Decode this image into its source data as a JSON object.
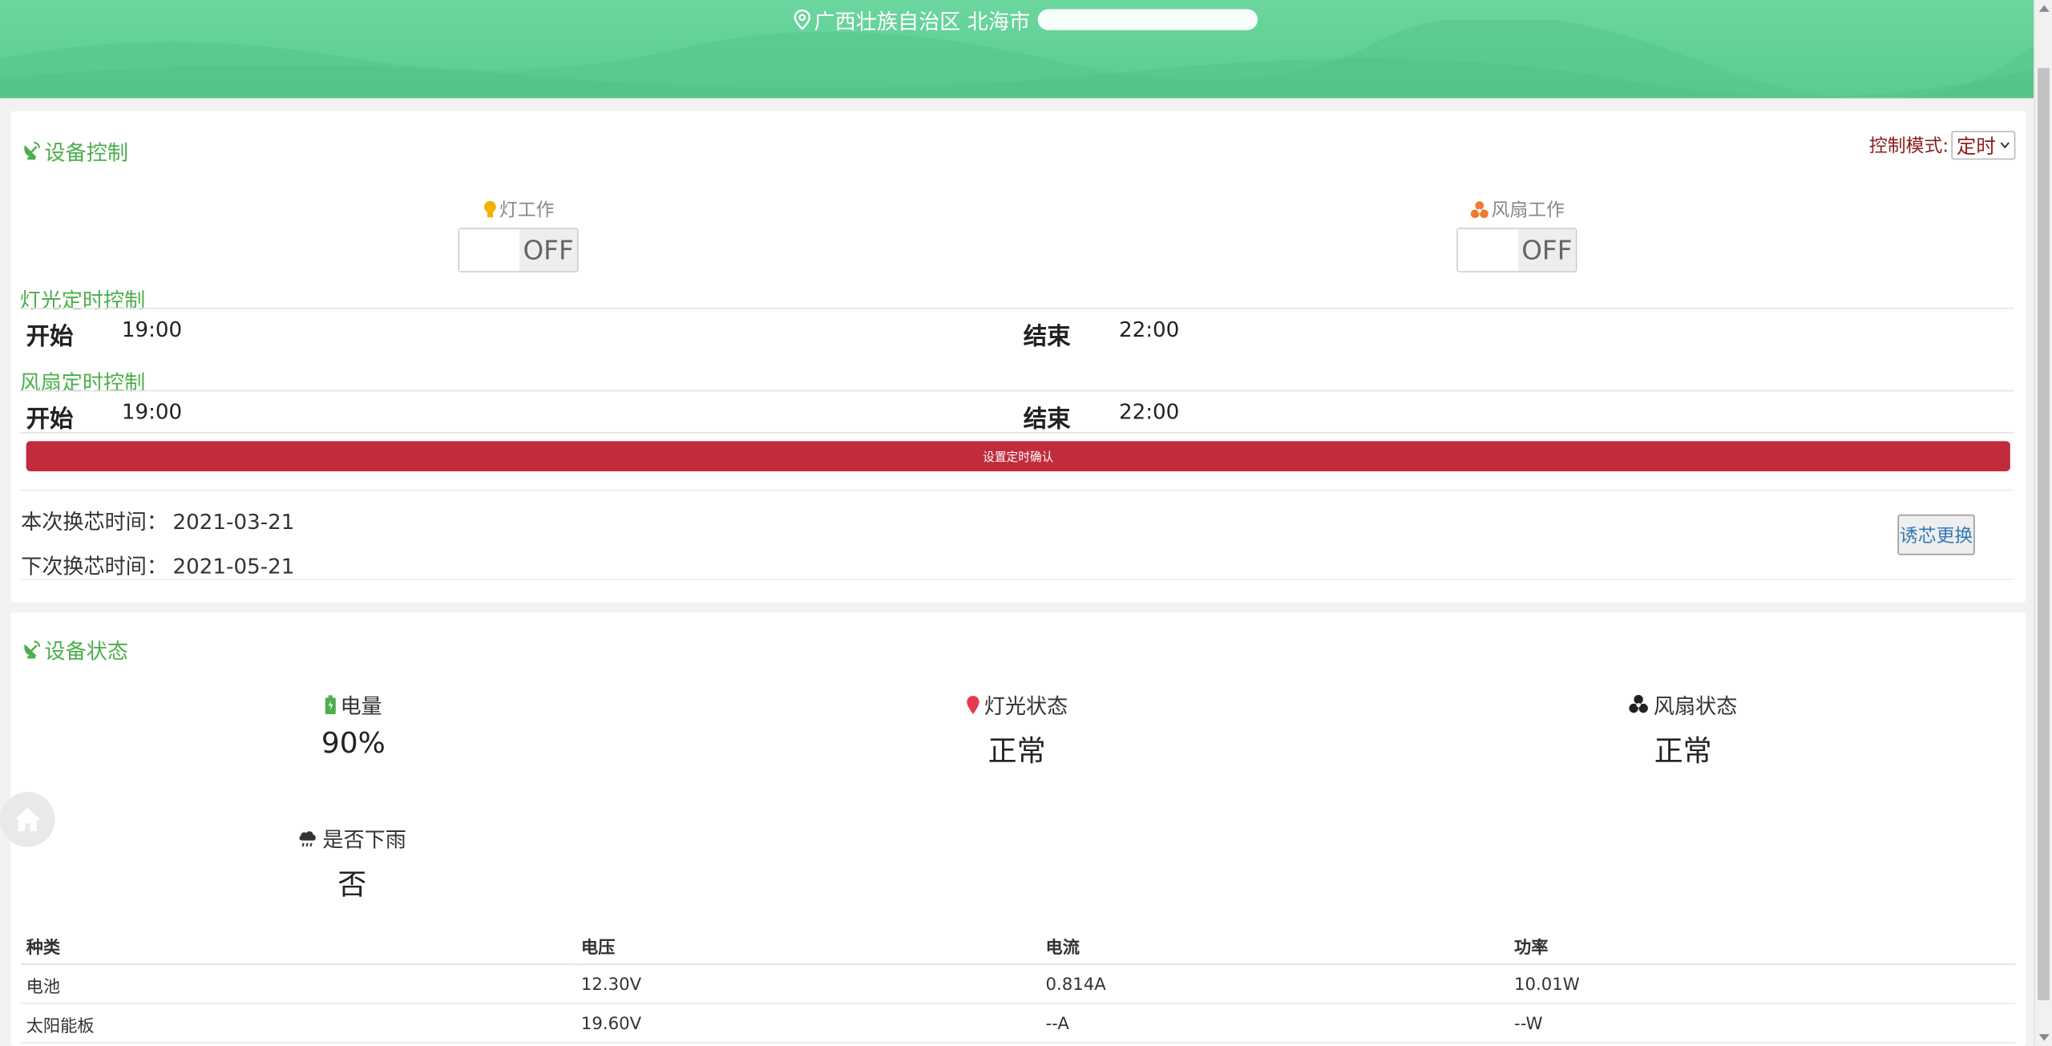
{
  "header": {
    "location_text": "广西壮族自治区 北海市"
  },
  "device_control": {
    "title": "设备控制",
    "mode_label": "控制模式:",
    "mode_value": "定时",
    "light_work_label": "灯工作",
    "light_toggle": "OFF",
    "fan_work_label": "风扇工作",
    "fan_toggle": "OFF",
    "light_timer": {
      "title": "灯光定时控制",
      "start_label": "开始",
      "start_value": "19:00",
      "end_label": "结束",
      "end_value": "22:00"
    },
    "fan_timer": {
      "title": "风扇定时控制",
      "start_label": "开始",
      "start_value": "19:00",
      "end_label": "结束",
      "end_value": "22:00"
    },
    "confirm_button": "设置定时确认",
    "this_change_label": "本次换芯时间：",
    "this_change_value": "2021-03-21",
    "next_change_label": "下次换芯时间：",
    "next_change_value": "2021-05-21",
    "replace_button": "诱芯更换"
  },
  "device_status": {
    "title": "设备状态",
    "battery_label": "电量",
    "battery_value": "90%",
    "light_status_label": "灯光状态",
    "light_status_value": "正常",
    "fan_status_label": "风扇状态",
    "fan_status_value": "正常",
    "rain_label": "是否下雨",
    "rain_value": "否"
  },
  "table": {
    "headers": [
      "种类",
      "电压",
      "电流",
      "功率"
    ],
    "rows": [
      [
        "电池",
        "12.30V",
        "0.814A",
        "10.01W"
      ],
      [
        "太阳能板",
        "19.60V",
        "--A",
        "--W"
      ]
    ]
  },
  "colors": {
    "header_green": "#5bcc91",
    "accent_green": "#4cae4c",
    "danger_red": "#c12b3a",
    "mode_red": "#8b2020",
    "link_blue": "#337ab7"
  }
}
